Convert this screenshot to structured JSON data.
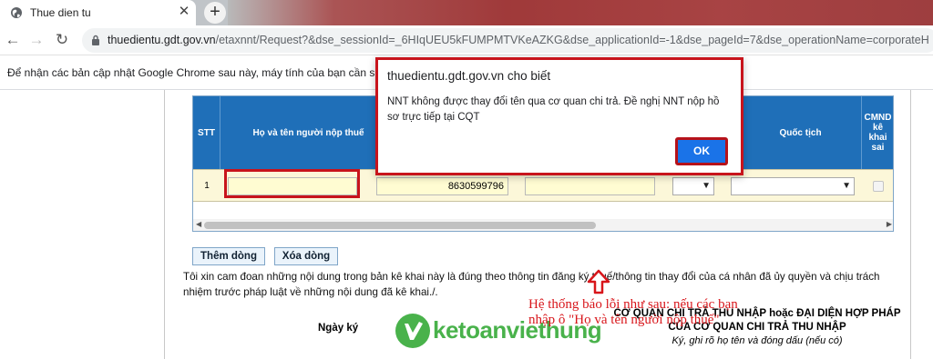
{
  "browser": {
    "tab_title": "Thue dien tu",
    "tab_close": "✕",
    "new_tab": "+",
    "url_host": "thuedientu.gdt.gov.vn",
    "url_path": "/etaxnnt/Request?&dse_sessionId=_6HIqUEU5kFUMPMTVKeAZKG&dse_applicationId=-1&dse_pageId=7&dse_operationName=corporateH",
    "infobar_text": "Để nhận các bản cập nhật Google Chrome sau này, máy tính của bạn cần sử d"
  },
  "table": {
    "headers": {
      "stt": "STT",
      "name": "Họ và tên người nộp thuế",
      "nationality": "Quốc tịch",
      "cmnd": "CMND kê khai sai"
    },
    "row": {
      "stt": "1",
      "tax_code": "8630599796"
    }
  },
  "buttons": {
    "add_row": "Thêm dòng",
    "delete_row": "Xóa dòng"
  },
  "declaration": "Tôi xin cam đoan những nội dung trong bản kê khai này là đúng theo thông tin đăng ký thuế/thông tin thay đổi của cá nhân đã ủy quyền và chịu trách nhiệm trước pháp luật về những nội dung đã kê khai./.",
  "signature": {
    "date_label": "Ngày ký",
    "org_line1": "CƠ QUAN CHI TRẢ THU NHẬP hoặc ĐẠI DIỆN HỢP PHÁP",
    "org_line2": "CỦA CƠ QUAN CHI TRẢ THU NHẬP",
    "note": "Ký, ghi rõ họ tên và đóng dấu (nếu có)"
  },
  "watermark": "ketoanviethung",
  "annotation": "Hệ thống báo lỗi như sau: nếu các bạn nhập ô \"Họ và tên người nộp thuế\"",
  "dialog": {
    "title": "thuedientu.gdt.gov.vn cho biết",
    "message": "NNT không được thay đổi tên qua cơ quan chi trả. Đề nghị NNT nộp hồ sơ trực tiếp tại CQT",
    "ok": "OK"
  },
  "colors": {
    "header_blue": "#1f6fb8",
    "alert_red": "#c8141c",
    "logo_green": "#49b24b"
  }
}
